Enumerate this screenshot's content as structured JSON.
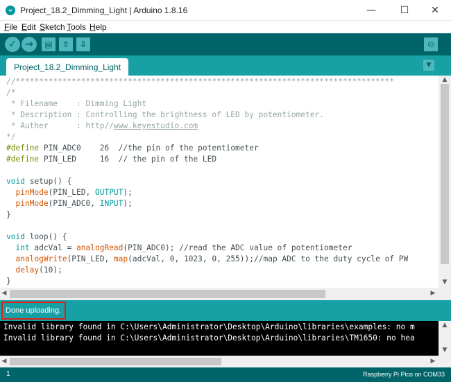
{
  "window": {
    "title": "Project_18.2_Dimming_Light | Arduino 1.8.16",
    "minimize": "—",
    "maximize": "☐",
    "close": "✕"
  },
  "menu": [
    {
      "label_ul": "F",
      "label_rest": "ile"
    },
    {
      "label_ul": "E",
      "label_rest": "dit"
    },
    {
      "label_ul": "S",
      "label_rest": "ketch"
    },
    {
      "label_ul": "T",
      "label_rest": "ools"
    },
    {
      "label_ul": "H",
      "label_rest": "elp"
    }
  ],
  "toolbar": {
    "verify_icon": "check-icon",
    "upload_icon": "arrow-right-icon",
    "new_icon": "file-icon",
    "open_icon": "arrow-up-icon",
    "save_icon": "arrow-down-icon",
    "serial_icon": "magnifier-icon"
  },
  "tab": {
    "label": "Project_18.2_Dimming_Light"
  },
  "code": {
    "stars": "//*********************************************************************************",
    "l2": "/*",
    "l3_a": " * Filename    : Dimming Light",
    "l4_a": " * Description : Controlling the brightness of LED by potentiometer.",
    "l5_a": " * Auther      : http//",
    "l5_link": "www.keyestudio.com",
    "l6": "*/",
    "l7_kw": "#define",
    "l7_rest": " PIN_ADC0    26  ",
    "l7_comment": "//the pin of the potentiometer",
    "l8_kw": "#define",
    "l8_rest": " PIN_LED     16  ",
    "l8_comment": "// the pin of the LED",
    "l10_type": "void",
    "l10_func": " setup",
    "l10_rest": "() {",
    "l11_func": "  pinMode",
    "l11_a": "(PIN_LED, ",
    "l11_const": "OUTPUT",
    "l11_b": ");",
    "l12_func": "  pinMode",
    "l12_a": "(PIN_ADC0, ",
    "l12_const": "INPUT",
    "l12_b": ");",
    "l13": "}",
    "l15_type": "void",
    "l15_func": " loop",
    "l15_rest": "() {",
    "l16_type": "  int",
    "l16_a": " adcVal = ",
    "l16_func": "analogRead",
    "l16_b": "(PIN_ADC0); ",
    "l16_comment": "//read the ADC value of potentiometer",
    "l17_func": "  analogWrite",
    "l17_a": "(PIN_LED, ",
    "l17_func2": "map",
    "l17_b": "(adcVal, 0, 1023, 0, 255));",
    "l17_comment": "//map ADC to the duty cycle of PW",
    "l18_func": "  delay",
    "l18_a": "(10);",
    "l19": "}"
  },
  "status": {
    "message": "Done uploading."
  },
  "console": {
    "lines": [
      "Invalid library found in C:\\Users\\Administrator\\Desktop\\Arduino\\libraries\\examples: no m",
      "Invalid library found in C:\\Users\\Administrator\\Desktop\\Arduino\\libraries\\TM1650: no hea"
    ]
  },
  "footer": {
    "line_number": "1",
    "board": "Raspberry Pi Pico on COM33"
  },
  "scroll": {
    "up": "▲",
    "down": "▼",
    "left": "◀",
    "right": "▶"
  },
  "colors": {
    "teal_dark": "#006468",
    "teal": "#17a1a5",
    "highlight_box": "#e0201b"
  }
}
